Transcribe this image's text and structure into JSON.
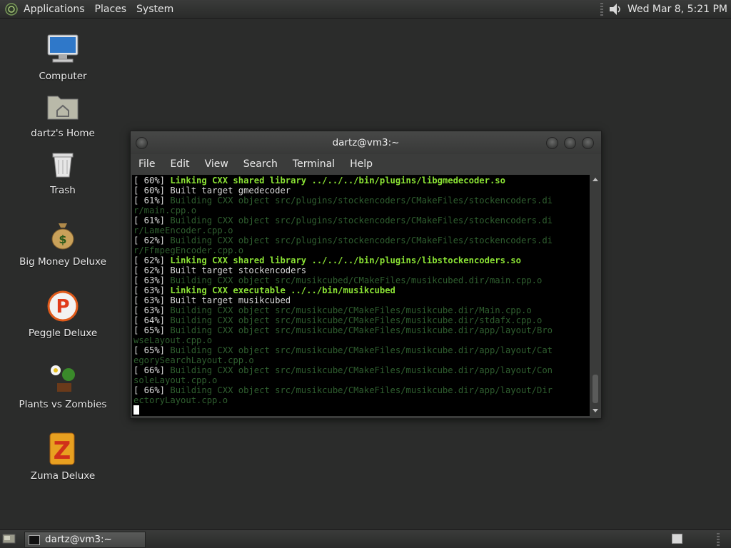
{
  "top_panel": {
    "menus": [
      "Applications",
      "Places",
      "System"
    ],
    "clock": "Wed Mar  8,  5:21 PM",
    "logo_icon": "gnome-foot-icon",
    "volume_icon": "speaker-icon"
  },
  "desktop": {
    "icons": [
      {
        "label": "Computer",
        "icon": "computer-icon"
      },
      {
        "label": "dartz's Home",
        "icon": "home-folder-icon"
      },
      {
        "label": "Trash",
        "icon": "trash-icon"
      },
      {
        "label": "Big Money Deluxe",
        "icon": "money-bag-icon"
      },
      {
        "label": "Peggle Deluxe",
        "icon": "peggle-icon"
      },
      {
        "label": "Plants vs Zombies",
        "icon": "plants-icon"
      },
      {
        "label": "Zuma Deluxe",
        "icon": "zuma-icon"
      }
    ]
  },
  "terminal": {
    "title": "dartz@vm3:~",
    "menu": [
      "File",
      "Edit",
      "View",
      "Search",
      "Terminal",
      "Help"
    ],
    "lines": [
      {
        "pct": "[ 60%] ",
        "text": "Linking CXX shared library ../../../bin/plugins/libgmedecoder.so",
        "style": "green"
      },
      {
        "pct": "[ 60%] ",
        "text": "Built target gmedecoder",
        "style": "norm"
      },
      {
        "pct": "[ 61%] ",
        "text": "Building CXX object src/plugins/stockencoders/CMakeFiles/stockencoders.di",
        "style": "dim"
      },
      {
        "pct": "",
        "text": "r/main.cpp.o",
        "style": "dim"
      },
      {
        "pct": "[ 61%] ",
        "text": "Building CXX object src/plugins/stockencoders/CMakeFiles/stockencoders.di",
        "style": "dim"
      },
      {
        "pct": "",
        "text": "r/LameEncoder.cpp.o",
        "style": "dim"
      },
      {
        "pct": "[ 62%] ",
        "text": "Building CXX object src/plugins/stockencoders/CMakeFiles/stockencoders.di",
        "style": "dim"
      },
      {
        "pct": "",
        "text": "r/FfmpegEncoder.cpp.o",
        "style": "dim"
      },
      {
        "pct": "[ 62%] ",
        "text": "Linking CXX shared library ../../../bin/plugins/libstockencoders.so",
        "style": "green"
      },
      {
        "pct": "[ 62%] ",
        "text": "Built target stockencoders",
        "style": "norm"
      },
      {
        "pct": "[ 63%] ",
        "text": "Building CXX object src/musikcubed/CMakeFiles/musikcubed.dir/main.cpp.o",
        "style": "dim"
      },
      {
        "pct": "[ 63%] ",
        "text": "Linking CXX executable ../../bin/musikcubed",
        "style": "green"
      },
      {
        "pct": "[ 63%] ",
        "text": "Built target musikcubed",
        "style": "norm"
      },
      {
        "pct": "[ 63%] ",
        "text": "Building CXX object src/musikcube/CMakeFiles/musikcube.dir/Main.cpp.o",
        "style": "dim"
      },
      {
        "pct": "[ 64%] ",
        "text": "Building CXX object src/musikcube/CMakeFiles/musikcube.dir/stdafx.cpp.o",
        "style": "dim"
      },
      {
        "pct": "[ 65%] ",
        "text": "Building CXX object src/musikcube/CMakeFiles/musikcube.dir/app/layout/Bro",
        "style": "dim"
      },
      {
        "pct": "",
        "text": "wseLayout.cpp.o",
        "style": "dim"
      },
      {
        "pct": "[ 65%] ",
        "text": "Building CXX object src/musikcube/CMakeFiles/musikcube.dir/app/layout/Cat",
        "style": "dim"
      },
      {
        "pct": "",
        "text": "egorySearchLayout.cpp.o",
        "style": "dim"
      },
      {
        "pct": "[ 66%] ",
        "text": "Building CXX object src/musikcube/CMakeFiles/musikcube.dir/app/layout/Con",
        "style": "dim"
      },
      {
        "pct": "",
        "text": "soleLayout.cpp.o",
        "style": "dim"
      },
      {
        "pct": "[ 66%] ",
        "text": "Building CXX object src/musikcube/CMakeFiles/musikcube.dir/app/layout/Dir",
        "style": "dim"
      },
      {
        "pct": "",
        "text": "ectoryLayout.cpp.o",
        "style": "dim"
      }
    ]
  },
  "bottom_panel": {
    "taskbar_label": "dartz@vm3:~",
    "show_desktop_icon": "show-desktop-icon",
    "workspace_icon": "workspace-switcher-icon"
  },
  "colors": {
    "desktop_bg": "#2b2c2b",
    "term_green": "#8ae234",
    "term_dim": "#2f5f2f",
    "term_text": "#d9d9d9"
  }
}
